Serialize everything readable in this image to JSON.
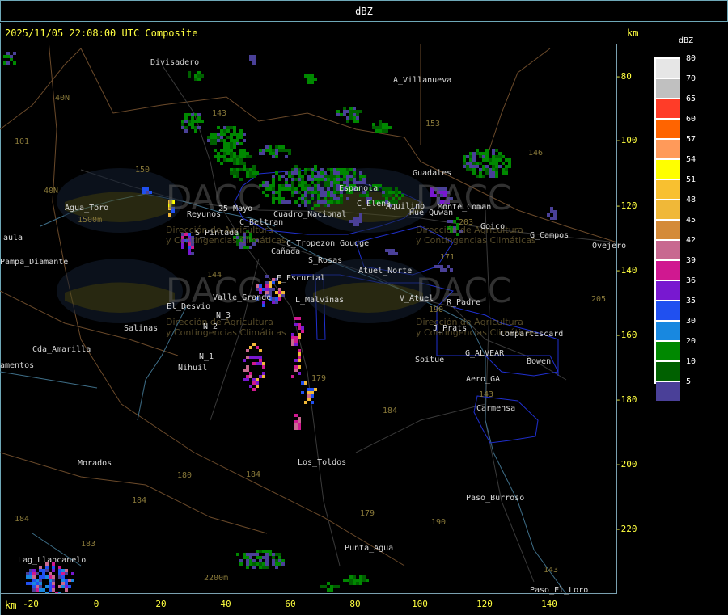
{
  "window": {
    "title": "dBZ"
  },
  "map": {
    "header": "2025/11/05 22:08:00 UTC Composite",
    "km_top": "km",
    "km_bottom": "km",
    "y_ticks": [
      "-80",
      "-100",
      "-120",
      "-140",
      "-160",
      "-180",
      "-200",
      "-220"
    ],
    "x_ticks": [
      "-20",
      "0",
      "20",
      "40",
      "60",
      "80",
      "100",
      "120",
      "140"
    ],
    "towns": [
      {
        "name": "Divisadero",
        "x": 186,
        "y": 72
      },
      {
        "name": "A_Villanueva",
        "x": 486,
        "y": 94
      },
      {
        "name": "Guadales",
        "x": 510,
        "y": 209
      },
      {
        "name": "Agua_Toro",
        "x": 80,
        "y": 252
      },
      {
        "name": "Reyunos",
        "x": 231,
        "y": 260
      },
      {
        "name": "25_Mayo",
        "x": 270,
        "y": 253
      },
      {
        "name": "S_Pintada",
        "x": 241,
        "y": 283
      },
      {
        "name": "Goico",
        "x": 594,
        "y": 275
      },
      {
        "name": "G_Campos",
        "x": 655,
        "y": 286
      },
      {
        "name": "Ovejero",
        "x": 732,
        "y": 299
      },
      {
        "name": "aula",
        "x": 4,
        "y": 289
      },
      {
        "name": "Pampa_Diamante",
        "x": 0,
        "y": 319
      },
      {
        "name": "C_Beltran",
        "x": 296,
        "y": 270
      },
      {
        "name": "Cuadro_Nacional",
        "x": 338,
        "y": 260
      },
      {
        "name": "C_Tropezon",
        "x": 354,
        "y": 296
      },
      {
        "name": "Goudge",
        "x": 420,
        "y": 296
      },
      {
        "name": "Cañada",
        "x": 335,
        "y": 306
      },
      {
        "name": "S_Rosas",
        "x": 381,
        "y": 317
      },
      {
        "name": "Atuel_Norte",
        "x": 443,
        "y": 330
      },
      {
        "name": "E_Escurial",
        "x": 342,
        "y": 339
      },
      {
        "name": "Valle_Grande",
        "x": 263,
        "y": 363
      },
      {
        "name": "L_Malvinas",
        "x": 365,
        "y": 366
      },
      {
        "name": "V_Atuel",
        "x": 494,
        "y": 364
      },
      {
        "name": "R_Padre",
        "x": 552,
        "y": 369
      },
      {
        "name": "El_Desvio",
        "x": 206,
        "y": 374
      },
      {
        "name": "N_3",
        "x": 267,
        "y": 385
      },
      {
        "name": "N_2",
        "x": 251,
        "y": 399
      },
      {
        "name": "Salinas",
        "x": 153,
        "y": 401
      },
      {
        "name": "J_Prats",
        "x": 535,
        "y": 401
      },
      {
        "name": "CompartEscard",
        "x": 618,
        "y": 408
      },
      {
        "name": "Cda_Amarilla",
        "x": 40,
        "y": 427
      },
      {
        "name": "G_ALVEAR",
        "x": 575,
        "y": 432
      },
      {
        "name": "N_1",
        "x": 246,
        "y": 436
      },
      {
        "name": "Soitue",
        "x": 513,
        "y": 440
      },
      {
        "name": "Bowen",
        "x": 651,
        "y": 442
      },
      {
        "name": "amentos",
        "x": 0,
        "y": 447
      },
      {
        "name": "Nihuil",
        "x": 220,
        "y": 450
      },
      {
        "name": "Aero_GA",
        "x": 576,
        "y": 464
      },
      {
        "name": "Carmensa",
        "x": 589,
        "y": 500
      },
      {
        "name": "Los_Toldos",
        "x": 368,
        "y": 567
      },
      {
        "name": "Morados",
        "x": 96,
        "y": 568
      },
      {
        "name": "Paso_Burroso",
        "x": 576,
        "y": 611
      },
      {
        "name": "Punta_Agua",
        "x": 426,
        "y": 673
      },
      {
        "name": "Lag_Llancanelo",
        "x": 22,
        "y": 688
      },
      {
        "name": "Paso_El_Loro",
        "x": 655,
        "y": 725
      },
      {
        "name": "C_Elena",
        "x": 441,
        "y": 247
      },
      {
        "name": "Aquilino",
        "x": 477,
        "y": 250
      },
      {
        "name": "Hue_Quwan",
        "x": 506,
        "y": 258
      },
      {
        "name": "Espanola",
        "x": 419,
        "y": 228
      },
      {
        "name": "Monte_Coman",
        "x": 541,
        "y": 251
      }
    ],
    "routes": [
      {
        "label": "40N",
        "x": 68,
        "y": 116
      },
      {
        "label": "101",
        "x": 18,
        "y": 170
      },
      {
        "label": "143",
        "x": 262,
        "y": 135
      },
      {
        "label": "153",
        "x": 526,
        "y": 148
      },
      {
        "label": "146",
        "x": 653,
        "y": 184
      },
      {
        "label": "150",
        "x": 167,
        "y": 205
      },
      {
        "label": "40N",
        "x": 54,
        "y": 231
      },
      {
        "label": "203",
        "x": 567,
        "y": 270
      },
      {
        "label": "171",
        "x": 544,
        "y": 313
      },
      {
        "label": "144",
        "x": 256,
        "y": 335
      },
      {
        "label": "205",
        "x": 731,
        "y": 365
      },
      {
        "label": "190",
        "x": 530,
        "y": 378
      },
      {
        "label": "179",
        "x": 385,
        "y": 463
      },
      {
        "label": "143",
        "x": 592,
        "y": 483
      },
      {
        "label": "184",
        "x": 473,
        "y": 503
      },
      {
        "label": "180",
        "x": 219,
        "y": 583
      },
      {
        "label": "184",
        "x": 304,
        "y": 582
      },
      {
        "label": "184",
        "x": 163,
        "y": 614
      },
      {
        "label": "184",
        "x": 18,
        "y": 637
      },
      {
        "label": "179",
        "x": 445,
        "y": 630
      },
      {
        "label": "190",
        "x": 533,
        "y": 641
      },
      {
        "label": "183",
        "x": 100,
        "y": 668
      },
      {
        "label": "143",
        "x": 672,
        "y": 700
      },
      {
        "label": "2200m",
        "x": 252,
        "y": 710
      },
      {
        "label": "1500m",
        "x": 96,
        "y": 267
      }
    ],
    "watermark": {
      "title": "DACC",
      "subtitle_line1": "Dirección de Agricultura",
      "subtitle_line2": "y Contingencias Climáticas"
    }
  },
  "legend": {
    "title": "dBZ",
    "entries": [
      {
        "label": "80",
        "color": "#e6e6e6"
      },
      {
        "label": "70",
        "color": "#c0c0c0"
      },
      {
        "label": "65",
        "color": "#ff3c28"
      },
      {
        "label": "60",
        "color": "#ff6400"
      },
      {
        "label": "57",
        "color": "#ff9a5a"
      },
      {
        "label": "54",
        "color": "#ffff00"
      },
      {
        "label": "51",
        "color": "#f8c030"
      },
      {
        "label": "48",
        "color": "#f0b838"
      },
      {
        "label": "45",
        "color": "#d48a38"
      },
      {
        "label": "42",
        "color": "#c86890"
      },
      {
        "label": "39",
        "color": "#d01890"
      },
      {
        "label": "36",
        "color": "#7818d0"
      },
      {
        "label": "35",
        "color": "#2050f0"
      },
      {
        "label": "30",
        "color": "#1888e0"
      },
      {
        "label": "20",
        "color": "#008800"
      },
      {
        "label": "10",
        "color": "#006000"
      },
      {
        "label": "5",
        "color": "#4a4098"
      }
    ]
  }
}
